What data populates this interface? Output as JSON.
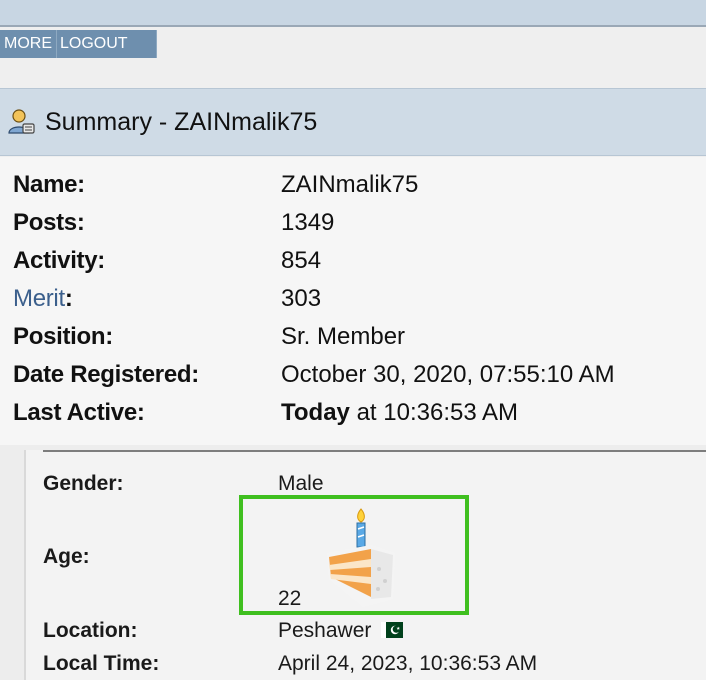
{
  "nav": {
    "tabs": [
      {
        "label": "MORE"
      },
      {
        "label": "LOGOUT"
      }
    ]
  },
  "summary": {
    "title": "Summary - ZAINmalik75",
    "icon": "user-icon"
  },
  "profile": {
    "name_label": "Name:",
    "name_value": "ZAINmalik75",
    "posts_label": "Posts:",
    "posts_value": "1349",
    "activity_label": "Activity:",
    "activity_value": "854",
    "merit_label": "Merit",
    "merit_colon": ":",
    "merit_value": "303",
    "position_label": "Position:",
    "position_value": "Sr. Member",
    "registered_label": "Date Registered:",
    "registered_value": "October 30, 2020, 07:55:10 AM",
    "last_active_label": "Last Active:",
    "last_active_bold": "Today",
    "last_active_rest": " at 10:36:53 AM"
  },
  "details": {
    "gender_label": "Gender:",
    "gender_value": "Male",
    "age_label": "Age:",
    "age_value": "22",
    "location_label": "Location:",
    "location_value": "Peshawer",
    "local_time_label": "Local Time:",
    "local_time_value": "April 24, 2023, 10:36:53 AM"
  },
  "colors": {
    "accent": "#6e8fae",
    "header_bg": "#cfdbe6",
    "highlight_box": "#3fbf1f",
    "merit_link": "#3b5f8c"
  }
}
